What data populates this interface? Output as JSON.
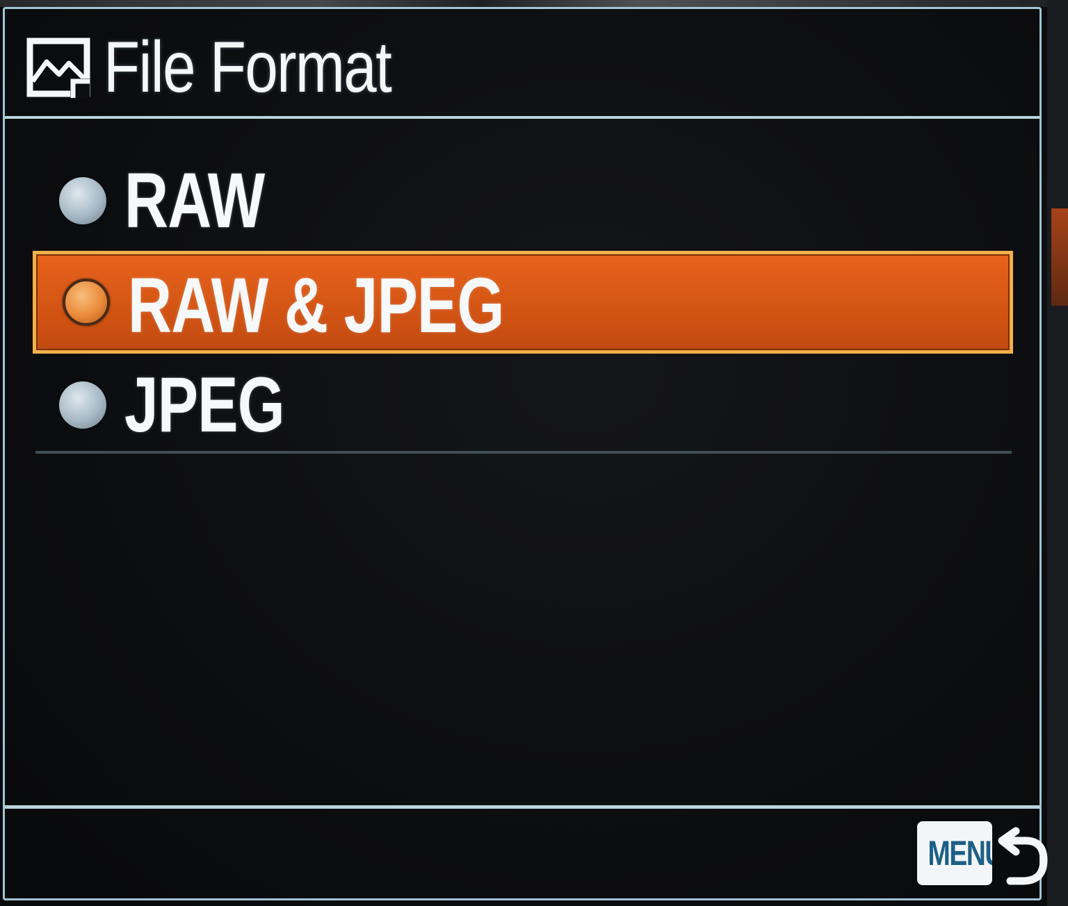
{
  "header": {
    "title": "File Format",
    "icon": "image-file-icon"
  },
  "options": [
    {
      "label": "RAW",
      "selected": false
    },
    {
      "label": "RAW & JPEG",
      "selected": true
    },
    {
      "label": "JPEG",
      "selected": false
    }
  ],
  "footer": {
    "menu_label": "MENU",
    "back_icon": "return-arrow-icon"
  },
  "colors": {
    "highlight": "#e8631c",
    "highlight_border": "#f2b04a",
    "frame": "#b8d4de",
    "background": "#0d0e11",
    "menu_button_text": "#1d5f86"
  }
}
